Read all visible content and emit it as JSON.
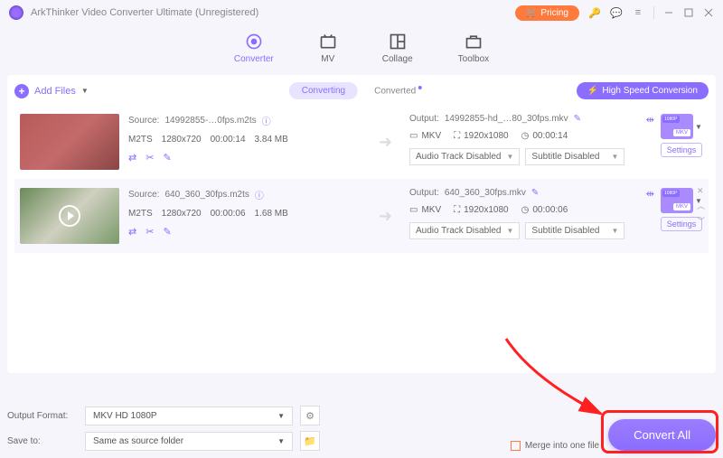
{
  "titlebar": {
    "title": "ArkThinker Video Converter Ultimate (Unregistered)",
    "pricing": "Pricing"
  },
  "tabs": {
    "converter": "Converter",
    "mv": "MV",
    "collage": "Collage",
    "toolbox": "Toolbox"
  },
  "toolbar": {
    "add_files": "Add Files",
    "converting": "Converting",
    "converted": "Converted",
    "high_speed": "High Speed Conversion"
  },
  "items": [
    {
      "source_label": "Source:",
      "source_name": "14992855-…0fps.m2ts",
      "format": "M2TS",
      "resolution": "1280x720",
      "duration": "00:00:14",
      "size": "3.84 MB",
      "output_label": "Output:",
      "output_name": "14992855-hd_…80_30fps.mkv",
      "out_format": "MKV",
      "out_resolution": "1920x1080",
      "out_duration": "00:00:14",
      "audio": "Audio Track Disabled",
      "subtitle": "Subtitle Disabled",
      "settings": "Settings"
    },
    {
      "source_label": "Source:",
      "source_name": "640_360_30fps.m2ts",
      "format": "M2TS",
      "resolution": "1280x720",
      "duration": "00:00:06",
      "size": "1.68 MB",
      "output_label": "Output:",
      "output_name": "640_360_30fps.mkv",
      "out_format": "MKV",
      "out_resolution": "1920x1080",
      "out_duration": "00:00:06",
      "audio": "Audio Track Disabled",
      "subtitle": "Subtitle Disabled",
      "settings": "Settings"
    }
  ],
  "bottom": {
    "output_format_label": "Output Format:",
    "output_format_value": "MKV HD 1080P",
    "save_to_label": "Save to:",
    "save_to_value": "Same as source folder",
    "merge_label": "Merge into one file",
    "convert_all": "Convert All"
  }
}
